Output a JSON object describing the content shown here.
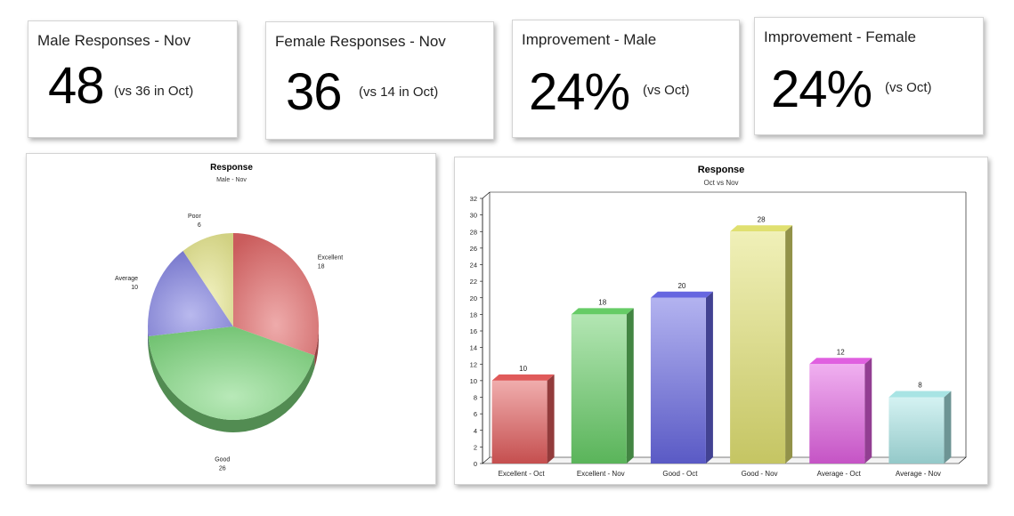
{
  "kpis": [
    {
      "title": "Male Responses - Nov",
      "value": "48",
      "sub": "(vs 36 in Oct)"
    },
    {
      "title": "Female Responses - Nov",
      "value": "36",
      "sub": "(vs 14 in Oct)"
    },
    {
      "title": "Improvement - Male",
      "value": "24%",
      "sub": "(vs Oct)"
    },
    {
      "title": "Improvement - Female",
      "value": "24%",
      "sub": "(vs Oct)"
    }
  ],
  "chart_data": [
    {
      "type": "pie",
      "title": "Response",
      "subtitle": "Male - Nov",
      "categories": [
        "Excellent",
        "Good",
        "Average",
        "Poor"
      ],
      "values": [
        18,
        26,
        10,
        6
      ],
      "colors": [
        "#e06666",
        "#7ed77e",
        "#8080e0",
        "#e8e890"
      ]
    },
    {
      "type": "bar",
      "title": "Response",
      "subtitle": "Oct vs Nov",
      "categories": [
        "Excellent - Oct",
        "Excellent - Nov",
        "Good - Oct",
        "Good - Nov",
        "Average - Oct",
        "Average - Nov"
      ],
      "values": [
        10,
        18,
        20,
        28,
        12,
        8
      ],
      "colors": [
        "#e05a5a",
        "#66cc66",
        "#6666e0",
        "#e0e070",
        "#e060e0",
        "#a8e4e4"
      ],
      "yticks": [
        0,
        2,
        4,
        6,
        8,
        10,
        12,
        14,
        16,
        18,
        20,
        22,
        24,
        26,
        28,
        30,
        32
      ],
      "ylim": [
        0,
        32
      ],
      "grid": false
    }
  ]
}
